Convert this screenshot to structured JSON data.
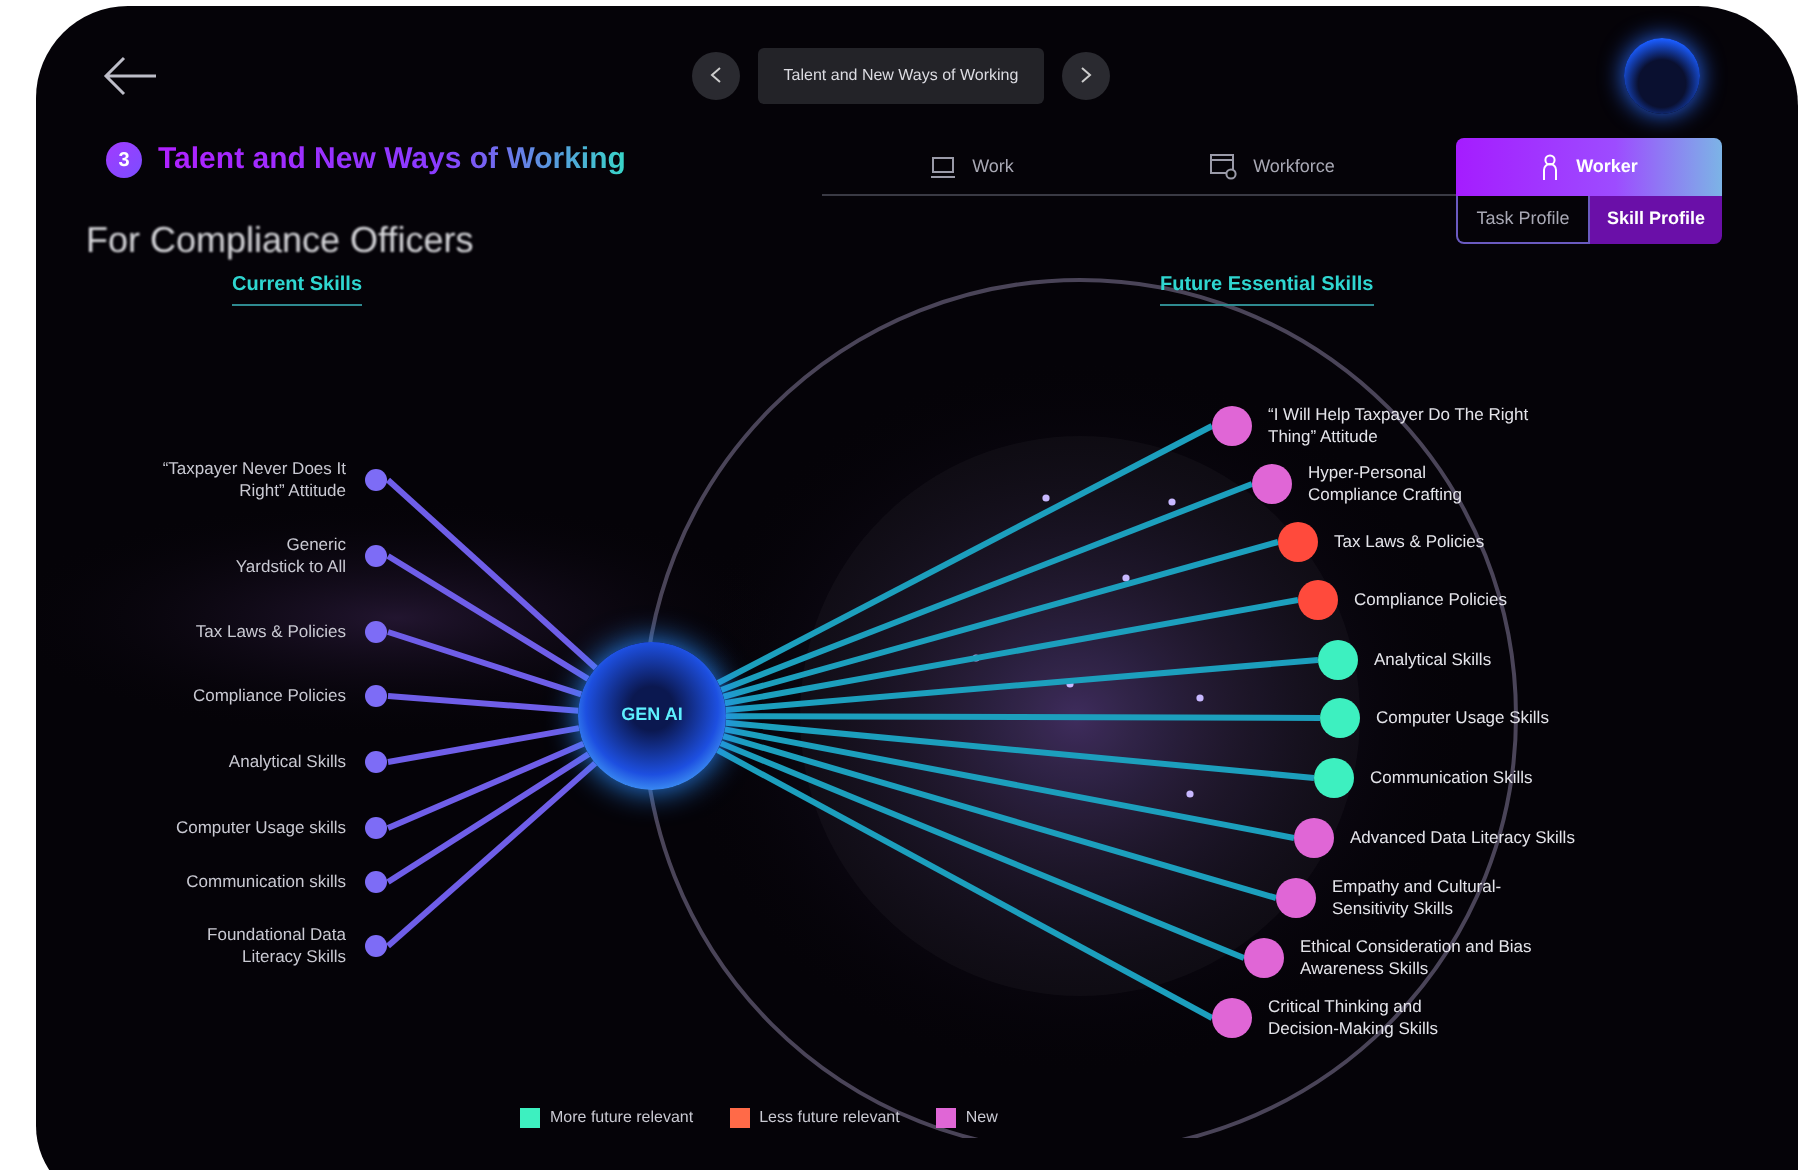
{
  "nav": {
    "title": "Talent and New Ways of Working"
  },
  "section": {
    "number": "3",
    "title": "Talent and New Ways of Working",
    "subtitle": "For Compliance Officers"
  },
  "tabs": [
    {
      "label": "Work",
      "selected": false
    },
    {
      "label": "Workforce",
      "selected": false
    },
    {
      "label": "Worker",
      "selected": true
    }
  ],
  "subtabs": [
    {
      "label": "Task Profile",
      "selected": false
    },
    {
      "label": "Skill Profile",
      "selected": true
    }
  ],
  "diagram": {
    "current_heading": "Current Skills",
    "future_heading": "Future Essential Skills",
    "hub_label": "GEN AI",
    "current_skills": [
      {
        "label": "“Taxpayer Never Does It\nRight” Attitude"
      },
      {
        "label": "Generic\nYardstick to All"
      },
      {
        "label": "Tax Laws & Policies"
      },
      {
        "label": "Compliance Policies"
      },
      {
        "label": "Analytical Skills"
      },
      {
        "label": "Computer Usage skills"
      },
      {
        "label": "Communication skills"
      },
      {
        "label": "Foundational Data\nLiteracy Skills"
      }
    ],
    "future_skills": [
      {
        "label": "“I Will Help Taxpayer Do The Right\nThing” Attitude",
        "color": "#e066d6"
      },
      {
        "label": "Hyper-Personal\nCompliance Crafting",
        "color": "#e066d6"
      },
      {
        "label": "Tax Laws & Policies",
        "color": "#ff4a3c"
      },
      {
        "label": "Compliance Policies",
        "color": "#ff4a3c"
      },
      {
        "label": "Analytical Skills",
        "color": "#3df0c0"
      },
      {
        "label": "Computer Usage Skills",
        "color": "#3df0c0"
      },
      {
        "label": "Communication Skills",
        "color": "#3df0c0"
      },
      {
        "label": "Advanced Data Literacy Skills",
        "color": "#e066d6"
      },
      {
        "label": "Empathy and Cultural-\nSensitivity Skills",
        "color": "#e066d6"
      },
      {
        "label": "Ethical Consideration and Bias\nAwareness Skills",
        "color": "#e066d6"
      },
      {
        "label": "Critical Thinking and\nDecision-Making Skills",
        "color": "#e066d6"
      }
    ]
  },
  "legend": [
    {
      "label": "More future relevant",
      "color": "#3df0c0"
    },
    {
      "label": "Less future relevant",
      "color": "#ff6a48"
    },
    {
      "label": "New",
      "color": "#e066d6"
    }
  ]
}
